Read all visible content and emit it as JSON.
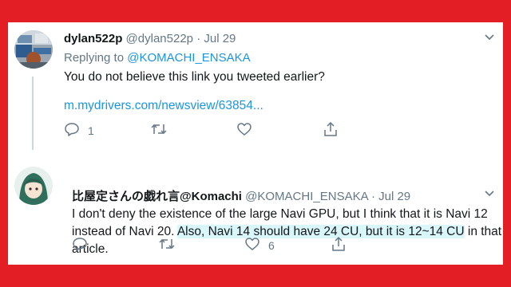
{
  "tweet1": {
    "display_name": "dylan522p",
    "handle": "@dylan522p",
    "sep": "·",
    "date": "Jul 29",
    "replying_prefix": "Replying to",
    "replying_mention": "@KOMACHI_ENSAKA",
    "text": "You do not believe this link you tweeted earlier?",
    "link": "m.mydrivers.com/newsview/63854...",
    "reply_count": "1",
    "retweet_count": "",
    "like_count": ""
  },
  "tweet2": {
    "display_name": "比屋定さんの戯れ言@Komachi",
    "handle": "@KOMACHI_ENSAKA",
    "sep": "·",
    "date": "Jul 29",
    "text_plain": "I don't deny the existence of the large Navi GPU, but I think that it is Navi 12 instead of Navi 20. ",
    "text_highlight": "Also, Navi 14 should have 24 CU, but it is 12~14 CU",
    "text_tail": " in that article.",
    "reply_count": "",
    "retweet_count": "",
    "like_count": "6"
  },
  "colors": {
    "background": "#e31e24",
    "link": "#1b95e0",
    "secondary_text": "#657786",
    "highlight": "#d9f6fb"
  },
  "icons": [
    "reply-icon",
    "retweet-icon",
    "like-icon",
    "share-icon",
    "chevron-down-icon"
  ]
}
